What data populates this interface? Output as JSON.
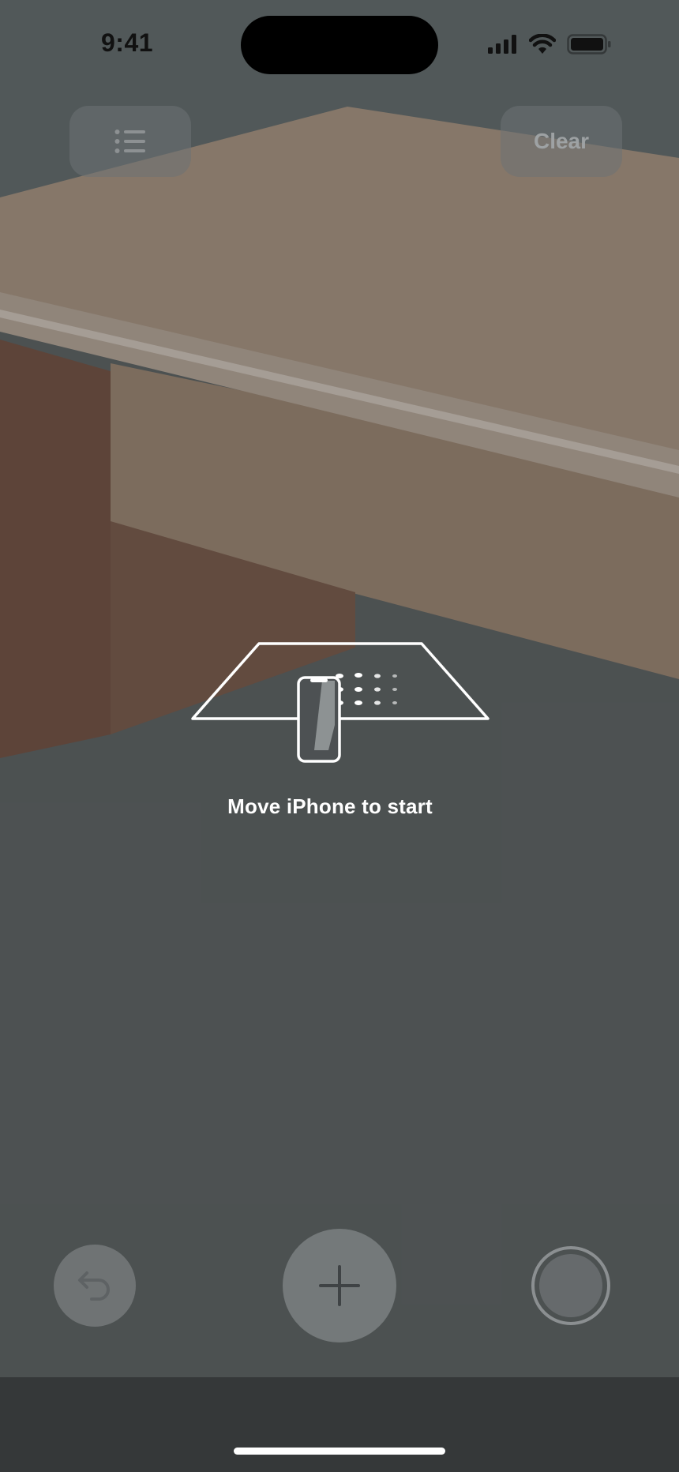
{
  "status_bar": {
    "time": "9:41"
  },
  "toolbar": {
    "list_icon": "list-icon",
    "clear_label": "Clear"
  },
  "coaching": {
    "message": "Move iPhone to start",
    "icon": "iphone-plane-icon"
  },
  "controls": {
    "undo_icon": "undo-arrow-icon",
    "add_icon": "plus-icon",
    "capture_icon": "shutter-icon"
  },
  "colors": {
    "overlay_text": "#ffffff",
    "button_fill": "#6e7274",
    "bottom_bar": "#353839"
  }
}
